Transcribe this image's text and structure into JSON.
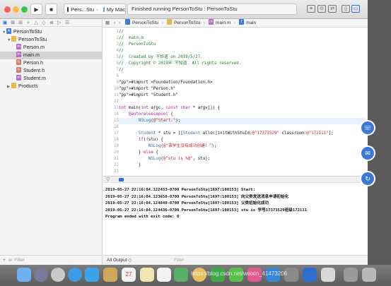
{
  "toolbar": {
    "scheme_target": "Pers...Stu",
    "scheme_device": "My Mac",
    "status": "Finished running PersonToStu : PersonToStu"
  },
  "navigator": {
    "items": [
      {
        "label": "PersonToStu",
        "kind": "project"
      },
      {
        "label": "PersonToStu",
        "kind": "folder"
      },
      {
        "label": "Person.m",
        "kind": "m"
      },
      {
        "label": "main.m",
        "kind": "m"
      },
      {
        "label": "Person.h",
        "kind": "h"
      },
      {
        "label": "Student.h",
        "kind": "h"
      },
      {
        "label": "Student.m",
        "kind": "m"
      },
      {
        "label": "Products",
        "kind": "folder"
      }
    ],
    "filter_placeholder": "Filter"
  },
  "jump_bar": {
    "crumbs": [
      "PersonToStu",
      "PersonToStu",
      "main.m",
      "main"
    ]
  },
  "editor": {
    "lines": [
      {
        "n": "1",
        "t": "//",
        "c": "cm"
      },
      {
        "n": "2",
        "t": "//  main.m",
        "c": "cm"
      },
      {
        "n": "3",
        "t": "//  PersonToStu",
        "c": "cm"
      },
      {
        "n": "4",
        "t": "//",
        "c": "cm"
      },
      {
        "n": "5",
        "t": "//  Created by 不知道 on 2019/5/27.",
        "c": "cm"
      },
      {
        "n": "6",
        "t": "//  Copyright © 2019年 不知道. All rights reserved.",
        "c": "cm"
      },
      {
        "n": "7",
        "t": "//",
        "c": "cm"
      },
      {
        "n": "8",
        "t": "",
        "c": ""
      },
      {
        "n": "9",
        "t": "#import <Foundation/Foundation.h>",
        "c": "pp"
      },
      {
        "n": "10",
        "t": "#import \"Person.h\"",
        "c": "pp"
      },
      {
        "n": "11",
        "t": "#import \"Student.h\"",
        "c": "pp"
      },
      {
        "n": "12",
        "t": "",
        "c": ""
      },
      {
        "n": "13",
        "t": "int main(int argc, const char * argv[]) {",
        "c": ""
      },
      {
        "n": "14",
        "t": "    @autoreleasepool {",
        "c": ""
      },
      {
        "n": "15",
        "t": "        NSLog(@\"Start:\");",
        "c": ""
      },
      {
        "n": "16",
        "t": "",
        "c": ""
      },
      {
        "n": "17",
        "t": "        Student * stu = [[Student alloc]initWithStuId:@\"17373529\" classroom:@\"172111\"];",
        "c": ""
      },
      {
        "n": "18",
        "t": "        if(!stu) {",
        "c": ""
      },
      {
        "n": "19",
        "t": "            NSLog(@\"该学生没有成功创建！\");",
        "c": ""
      },
      {
        "n": "20",
        "t": "        } else {",
        "c": ""
      },
      {
        "n": "21",
        "t": "            NSLog(@\"stu is %@\", stu);",
        "c": ""
      },
      {
        "n": "22",
        "t": "        }",
        "c": ""
      },
      {
        "n": "23",
        "t": "",
        "c": ""
      },
      {
        "n": "24",
        "t": "    }",
        "c": ""
      }
    ]
  },
  "console": {
    "lines": [
      "2019-05-27 22:16:04.122433-0700 PersonToStu[1697:100153] Start:",
      "2019-05-27 22:16:04.123658-0700 PersonToStu[1697:100153] 向父类发送消息申请初始化",
      "2019-05-27 22:16:04.124049-0700 PersonToStu[1697:100153] 父类初始化成功",
      "2019-05-27 22:16:04.124436-0700 PersonToStu[1697:100153] stu is 学号17373529班级172111",
      "Program ended with exit code: 0"
    ],
    "output_selector": "All Output ◇",
    "filter_placeholder": "Filter"
  },
  "watermark": "https://blog.csdn.net/weixin_41473206"
}
